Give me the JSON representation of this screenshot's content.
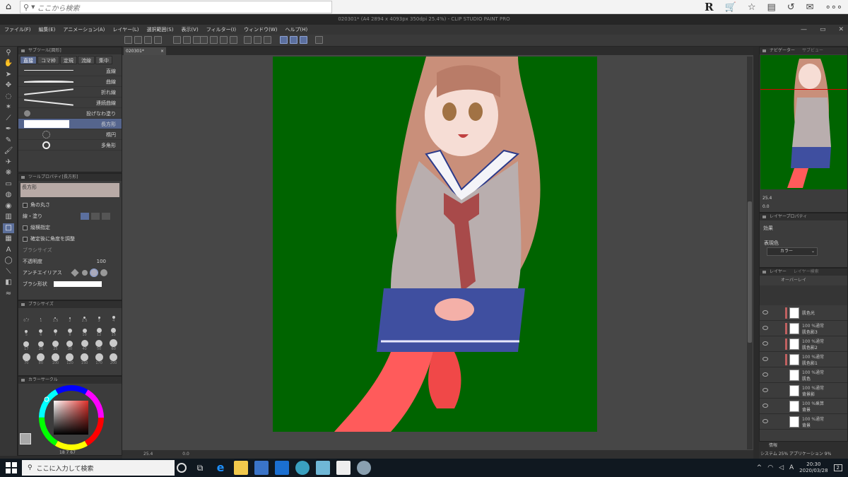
{
  "browser": {
    "search_placeholder": "ここから検索",
    "toolbar_icons": [
      "r-logo",
      "cart-icon",
      "star-icon",
      "list-icon",
      "refresh-icon",
      "mail-icon",
      "more-icon"
    ]
  },
  "window": {
    "title": "020301* (A4 2894 x 4093px 350dpi 25.4%) - CLIP STUDIO PAINT PRO"
  },
  "menu": {
    "items": [
      "ファイル(F)",
      "編集(E)",
      "アニメーション(A)",
      "レイヤー(L)",
      "選択範囲(S)",
      "表示(V)",
      "フィルター(I)",
      "ウィンドウ(W)",
      "ヘルプ(H)"
    ]
  },
  "subtool": {
    "header": "サブツール[図形]",
    "tabs": [
      "直接",
      "コマ枠",
      "定規",
      "流線",
      "集中"
    ],
    "active_tab": "直接",
    "items": [
      "直線",
      "曲線",
      "折れ線",
      "連続曲線",
      "投げなわ塗り",
      "長方形",
      "楕円",
      "多角形"
    ],
    "selected_item": "長方形"
  },
  "tool_property": {
    "header": "ツールプロパティ[長方形]",
    "preview_label": "長方形",
    "corner_round": "角の丸さ",
    "line_fill": "線・塗り",
    "aspect": "縦横指定",
    "adjust_angle": "確定後に角度を調整",
    "brush_size": "ブラシサイズ",
    "opacity_label": "不透明度",
    "opacity_value": "100",
    "antialias": "アンチエイリアス",
    "brush_shape": "ブラシ形状"
  },
  "brush_sizes": {
    "header": "ブラシサイズ",
    "values": [
      "0.7",
      "1",
      "1.5",
      "2",
      "2.5",
      "3",
      "4",
      "5",
      "6",
      "7",
      "8",
      "10",
      "12",
      "15",
      "17",
      "20",
      "25",
      "30",
      "40",
      "50",
      "60",
      "70",
      "80",
      "100",
      "120",
      "150",
      "170",
      "200"
    ]
  },
  "color_circle": {
    "header": "カラーサークル",
    "readout": "18  7  67",
    "main_color": "#a8a8a8",
    "hue_color": "#e0302a"
  },
  "canvas": {
    "tab": "020301*",
    "zoom": "25.4",
    "rotation": "0.0",
    "bg_color": "#006400"
  },
  "navigator": {
    "tabs": [
      "ナビゲーター",
      "サブビュー"
    ],
    "zoom": "25.4",
    "rotation": "0.0"
  },
  "layer_property": {
    "header": "レイヤープロパティ",
    "effect_label": "効果",
    "display_color_label": "表現色",
    "display_color_value": "カラー"
  },
  "layers": {
    "tabs": [
      "レイヤー",
      "レイヤー検索"
    ],
    "blend": "オーバーレイ",
    "rows": [
      {
        "mode": "",
        "name": "肌色光"
      },
      {
        "mode": "100 %通常",
        "name": "肌色影3"
      },
      {
        "mode": "100 %通常",
        "name": "肌色影2"
      },
      {
        "mode": "100 %通常",
        "name": "肌色影1"
      },
      {
        "mode": "100 %通常",
        "name": "肌色"
      },
      {
        "mode": "100 %通常",
        "name": "背景影"
      },
      {
        "mode": "100 %乗算",
        "name": "背景"
      },
      {
        "mode": "100 %通常",
        "name": "背景"
      }
    ]
  },
  "info": {
    "tab": "情報",
    "system": "システム 25%",
    "app": "アプリケーション 9%"
  },
  "taskbar": {
    "search_placeholder": "ここに入力して検索",
    "time": "20:30",
    "date": "2020/03/28",
    "ime": "A",
    "notif": "2"
  }
}
